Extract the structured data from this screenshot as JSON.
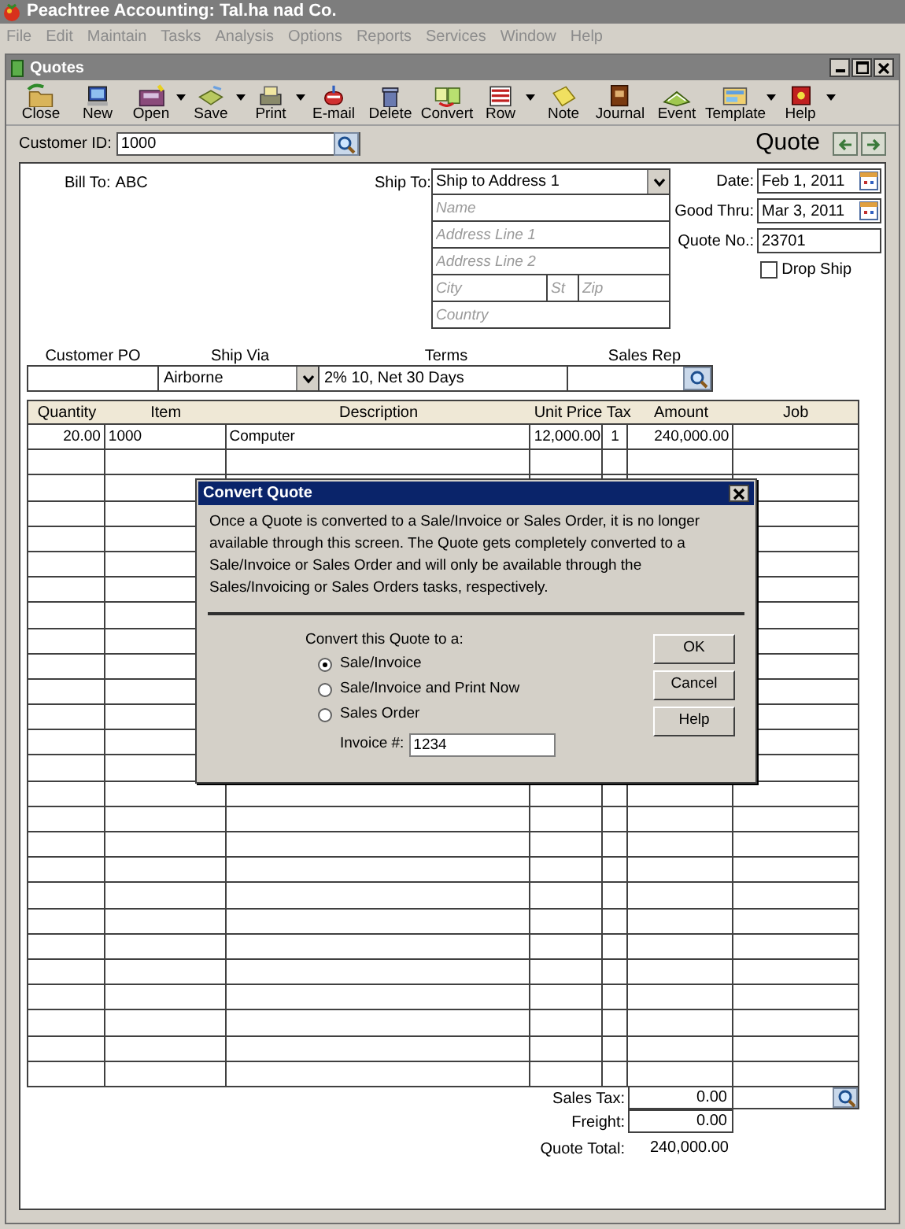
{
  "app": {
    "title": "Peachtree Accounting: Tal.ha nad Co."
  },
  "menu": [
    {
      "label": "File",
      "disabled": true
    },
    {
      "label": "Edit",
      "disabled": true
    },
    {
      "label": "Maintain",
      "disabled": true
    },
    {
      "label": "Tasks",
      "disabled": true
    },
    {
      "label": "Analysis",
      "disabled": true
    },
    {
      "label": "Options",
      "disabled": true
    },
    {
      "label": "Reports",
      "disabled": true
    },
    {
      "label": "Services",
      "disabled": true
    },
    {
      "label": "Window",
      "disabled": true
    },
    {
      "label": "Help",
      "disabled": true
    }
  ],
  "window": {
    "title": "Quotes"
  },
  "toolbar": [
    {
      "label": "Close",
      "dropdown": false
    },
    {
      "label": "New",
      "dropdown": false
    },
    {
      "label": "Open",
      "dropdown": true
    },
    {
      "label": "Save",
      "dropdown": true
    },
    {
      "label": "Print",
      "dropdown": true
    },
    {
      "label": "E-mail",
      "dropdown": false
    },
    {
      "label": "Delete",
      "dropdown": false
    },
    {
      "label": "Convert",
      "dropdown": false
    },
    {
      "label": "Row",
      "dropdown": true
    },
    {
      "label": "Note",
      "dropdown": false
    },
    {
      "label": "Journal",
      "dropdown": false
    },
    {
      "label": "Event",
      "dropdown": false
    },
    {
      "label": "Template",
      "dropdown": true
    },
    {
      "label": "Help",
      "dropdown": true
    }
  ],
  "customer": {
    "label": "Customer ID:",
    "value": "1000"
  },
  "heading": "Quote",
  "bill_to": {
    "label": "Bill To:",
    "value": "ABC"
  },
  "ship_to": {
    "label": "Ship To:",
    "value": "Ship to Address 1",
    "address_rows": [
      [
        {
          "placeholder": "Name"
        }
      ],
      [
        {
          "placeholder": "Address Line 1"
        }
      ],
      [
        {
          "placeholder": "Address Line 2"
        }
      ],
      [
        {
          "placeholder": "City"
        },
        {
          "placeholder": "St"
        },
        {
          "placeholder": "Zip"
        }
      ],
      [
        {
          "placeholder": "Country"
        }
      ]
    ]
  },
  "dates": [
    {
      "label": "Date:",
      "value": "Feb 1, 2011",
      "kind": "date"
    },
    {
      "label": "Good Thru:",
      "value": "Mar 3, 2011",
      "kind": "date"
    },
    {
      "label": "Quote No.:",
      "value": "23701",
      "kind": "text"
    }
  ],
  "drop_ship": {
    "label": "Drop Ship",
    "checked": false
  },
  "header_fields": [
    {
      "label": "Customer PO",
      "kind": "text"
    },
    {
      "label": "Ship Via",
      "value": "Airborne",
      "kind": "dropdown"
    },
    {
      "label": "Terms",
      "value": "2% 10, Net 30 Days",
      "kind": "text"
    },
    {
      "label": "Sales Rep",
      "kind": "lookup"
    }
  ],
  "table": {
    "columns": [
      "Quantity",
      "Item",
      "Description",
      "Unit Price",
      "Tax",
      "Amount",
      "Job"
    ],
    "rows": [
      [
        "20.00",
        "1000",
        "Computer",
        "12,000.00",
        "1",
        "240,000.00"
      ]
    ]
  },
  "totals": {
    "sales_tax_label": "Sales Tax:",
    "sales_tax": "0.00",
    "freight_label": "Freight:",
    "freight": "0.00",
    "total_label": "Quote Total:",
    "total": "240,000.00"
  },
  "dialog": {
    "title": "Convert Quote",
    "message": "Once a Quote is converted to a Sale/Invoice or Sales Order, it is no longer available through this screen. The Quote gets completely converted to a Sale/Invoice or Sales Order and will only be available through the Sales/Invoicing or Sales Orders tasks, respectively.",
    "prompt": "Convert this Quote to a:",
    "options": [
      {
        "label": "Sale/Invoice",
        "selected": true
      },
      {
        "label": "Sale/Invoice and Print Now",
        "selected": false
      },
      {
        "label": "Sales Order",
        "selected": false
      }
    ],
    "invoice_label": "Invoice #:",
    "invoice_value": "1234",
    "buttons": [
      "OK",
      "Cancel",
      "Help"
    ]
  }
}
